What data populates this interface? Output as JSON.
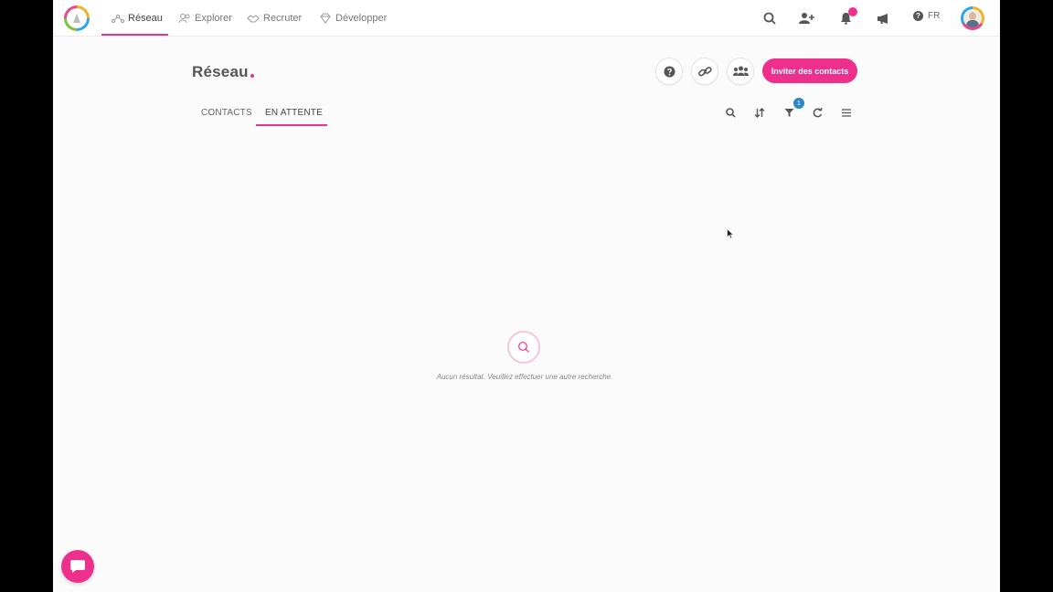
{
  "nav": {
    "tabs": [
      {
        "label": "Réseau",
        "icon": "network-icon",
        "active": true
      },
      {
        "label": "Explorer",
        "icon": "people-icon",
        "active": false
      },
      {
        "label": "Recruter",
        "icon": "handshake-icon",
        "active": false
      },
      {
        "label": "Développer",
        "icon": "diamond-icon",
        "active": false
      }
    ],
    "language": "FR"
  },
  "page": {
    "title": "Réseau",
    "invite_button": "Inviter des contacts",
    "tabs": [
      {
        "label": "CONTACTS",
        "active": false
      },
      {
        "label": "EN ATTENTE",
        "active": true
      }
    ],
    "filter_count": "1",
    "empty_message": "Aucun résultat. Veuillez effectuer une autre recherche."
  },
  "colors": {
    "accent": "#ef2f8c",
    "badge_blue": "#2d86c9"
  }
}
